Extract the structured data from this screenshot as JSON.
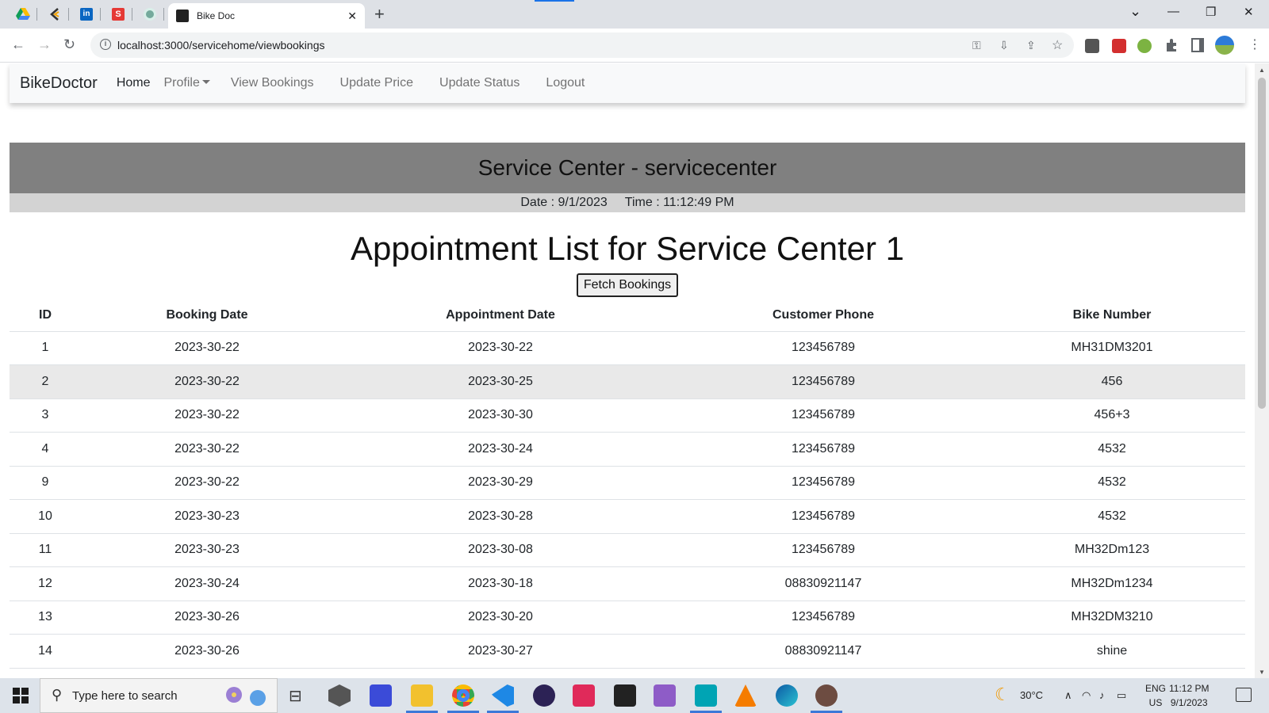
{
  "browser": {
    "tab_title": "Bike Doc",
    "tab_close": "✕",
    "new_tab": "+",
    "url": "localhost:3000/servicehome/viewbookings",
    "info_glyph": "i",
    "pinned_tabs": [
      "google-drive",
      "custom-c",
      "linkedin",
      "s-app",
      "chatgpt"
    ],
    "window": {
      "tablist": "⌄",
      "minimize": "—",
      "restore": "❐",
      "close": "✕"
    },
    "nav": {
      "back": "←",
      "forward": "→",
      "reload": "↻"
    },
    "omnibox_icons": {
      "key": "⚿",
      "install": "⇩",
      "share": "⇪",
      "bookmark": "☆"
    },
    "menu": "⋮"
  },
  "navbar": {
    "brand": "BikeDoctor",
    "home": "Home",
    "profile": "Profile",
    "view_bookings": "View Bookings",
    "update_price": "Update Price",
    "update_status": "Update Status",
    "logout": "Logout"
  },
  "banner": {
    "title": "Service Center - servicecenter",
    "date": "Date : 9/1/2023",
    "time": "Time : 11:12:49 PM"
  },
  "main": {
    "title": "Appointment List for Service Center 1",
    "fetch_button": "Fetch Bookings"
  },
  "table": {
    "headers": {
      "id": "ID",
      "booking_date": "Booking Date",
      "appointment_date": "Appointment Date",
      "customer_phone": "Customer Phone",
      "bike_number": "Bike Number"
    },
    "rows": [
      {
        "id": "1",
        "booking_date": "2023-30-22",
        "appointment_date": "2023-30-22",
        "customer_phone": "123456789",
        "bike_number": "MH31DM3201"
      },
      {
        "id": "2",
        "booking_date": "2023-30-22",
        "appointment_date": "2023-30-25",
        "customer_phone": "123456789",
        "bike_number": "456"
      },
      {
        "id": "3",
        "booking_date": "2023-30-22",
        "appointment_date": "2023-30-30",
        "customer_phone": "123456789",
        "bike_number": "456+3"
      },
      {
        "id": "4",
        "booking_date": "2023-30-22",
        "appointment_date": "2023-30-24",
        "customer_phone": "123456789",
        "bike_number": "4532"
      },
      {
        "id": "9",
        "booking_date": "2023-30-22",
        "appointment_date": "2023-30-29",
        "customer_phone": "123456789",
        "bike_number": "4532"
      },
      {
        "id": "10",
        "booking_date": "2023-30-23",
        "appointment_date": "2023-30-28",
        "customer_phone": "123456789",
        "bike_number": "4532"
      },
      {
        "id": "11",
        "booking_date": "2023-30-23",
        "appointment_date": "2023-30-08",
        "customer_phone": "123456789",
        "bike_number": "MH32Dm123"
      },
      {
        "id": "12",
        "booking_date": "2023-30-24",
        "appointment_date": "2023-30-18",
        "customer_phone": "08830921147",
        "bike_number": "MH32Dm1234"
      },
      {
        "id": "13",
        "booking_date": "2023-30-26",
        "appointment_date": "2023-30-20",
        "customer_phone": "123456789",
        "bike_number": "MH32DM3210"
      },
      {
        "id": "14",
        "booking_date": "2023-30-26",
        "appointment_date": "2023-30-27",
        "customer_phone": "08830921147",
        "bike_number": "shine"
      }
    ]
  },
  "taskbar": {
    "search_placeholder": "Type here to search",
    "search_glyph": "⚲",
    "task_view_glyph": "⊟",
    "weather": "30°C",
    "weather_glyph": "☾",
    "tray_glyphs": {
      "chevron": "∧",
      "wifi": "◠",
      "volume": "♪",
      "battery": "▭"
    },
    "lang_top": "ENG",
    "lang_bottom": "US",
    "time": "11:12 PM",
    "date": "9/1/2023"
  },
  "colors": {
    "banner_bg": "#808080",
    "date_bar_bg": "#d3d3d3",
    "navbar_bg": "#f8f9fa",
    "striped_row": "#e9e9e9"
  }
}
